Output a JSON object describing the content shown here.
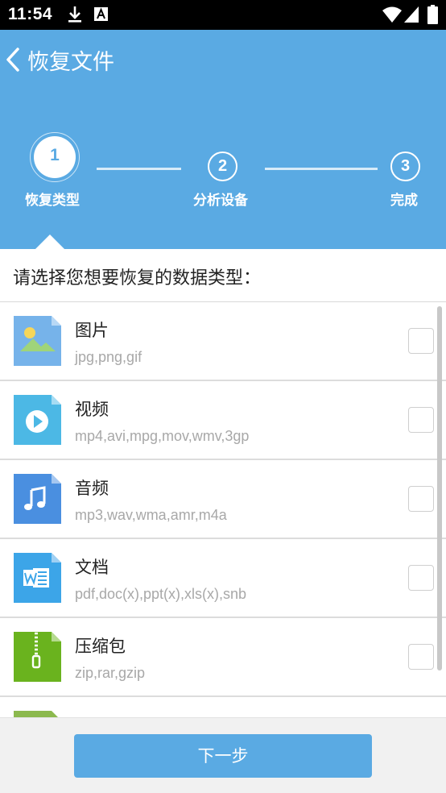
{
  "status_bar": {
    "time": "11:54"
  },
  "header": {
    "title": "恢复文件"
  },
  "steps": [
    {
      "number": "1",
      "label": "恢复类型"
    },
    {
      "number": "2",
      "label": "分析设备"
    },
    {
      "number": "3",
      "label": "完成"
    }
  ],
  "prompt": "请选择您想要恢复的数据类型：",
  "file_types": [
    {
      "title": "图片",
      "formats": "jpg,png,gif",
      "icon": "image-file-icon",
      "color": "#76b3ea"
    },
    {
      "title": "视频",
      "formats": "mp4,avi,mpg,mov,wmv,3gp",
      "icon": "video-file-icon",
      "color": "#4cb8e5"
    },
    {
      "title": "音频",
      "formats": "mp3,wav,wma,amr,m4a",
      "icon": "audio-file-icon",
      "color": "#4a8fe0"
    },
    {
      "title": "文档",
      "formats": "pdf,doc(x),ppt(x),xls(x),snb",
      "icon": "word-document-icon",
      "color": "#3ca5e8"
    },
    {
      "title": "压缩包",
      "formats": "zip,rar,gzip",
      "icon": "zip-archive-icon",
      "color": "#6ab31e"
    }
  ],
  "footer": {
    "next_label": "下一步"
  },
  "colors": {
    "primary": "#5aaae3"
  }
}
